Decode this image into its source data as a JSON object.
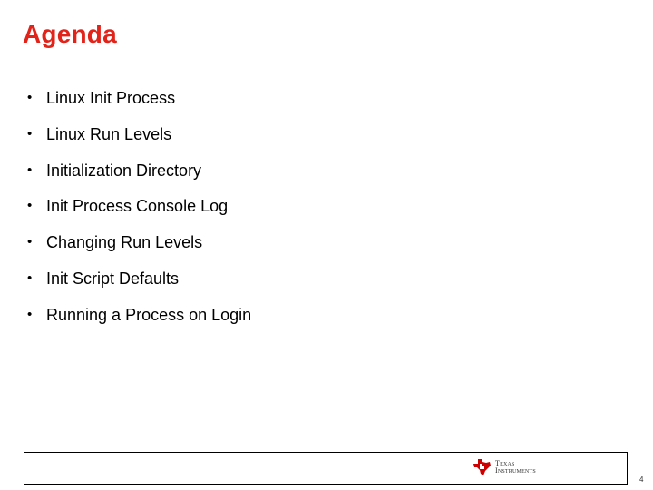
{
  "slide": {
    "title": "Agenda",
    "bullet_glyph": "•",
    "bullets": [
      "Linux Init Process",
      "Linux Run Levels",
      "Initialization Directory",
      "Init Process Console Log",
      "Changing Run Levels",
      "Init Script Defaults",
      "Running a Process on Login"
    ]
  },
  "footer": {
    "logo_icon": "texas-instruments-logo-icon",
    "logo_line1": "Texas",
    "logo_line2": "Instruments",
    "page_number": "4"
  },
  "colors": {
    "title": "#e2231a",
    "logo": "#cc0000"
  }
}
